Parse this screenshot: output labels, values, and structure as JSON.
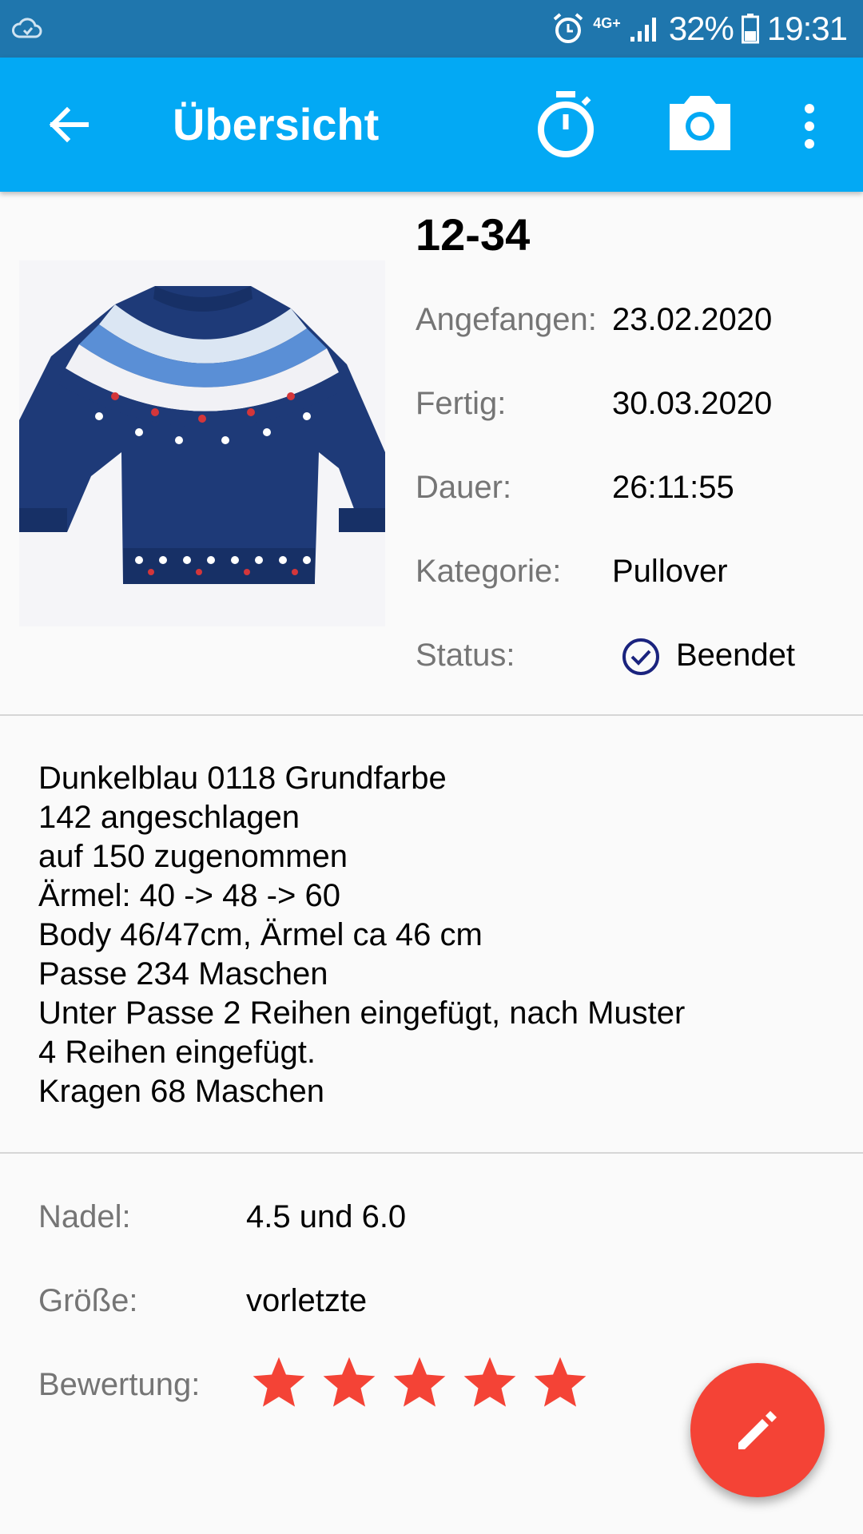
{
  "status_bar": {
    "network": "4G+",
    "battery": "32%",
    "time": "19:31"
  },
  "app_bar": {
    "title": "Übersicht",
    "back_icon": "arrow-back-icon",
    "timer_icon": "timer-icon",
    "camera_icon": "camera-icon",
    "overflow_icon": "more-vert-icon"
  },
  "item": {
    "title": "12-34",
    "photo_icon": "sweater-photo",
    "fields": [
      {
        "label": "Angefangen:",
        "value": "23.02.2020"
      },
      {
        "label": "Fertig:",
        "value": "30.03.2020"
      },
      {
        "label": "Dauer:",
        "value": "26:11:55"
      },
      {
        "label": "Kategorie:",
        "value": "Pullover"
      }
    ],
    "status": {
      "label": "Status:",
      "value": "Beendet",
      "icon": "check-circle-icon"
    }
  },
  "notes": [
    "Dunkelblau 0118 Grundfarbe",
    "142 angeschlagen",
    "auf 150 zugenommen",
    "Ärmel: 40 -> 48 -> 60",
    "Body 46/47cm, Ärmel ca 46 cm",
    "Passe 234 Maschen",
    "Unter Passe 2 Reihen eingefügt, nach Muster",
    "4 Reihen eingefügt.",
    "Kragen 68 Maschen"
  ],
  "details": {
    "needle": {
      "label": "Nadel:",
      "value": "4.5 und 6.0"
    },
    "size": {
      "label": "Größe:",
      "value": "vorletzte"
    },
    "rating": {
      "label": "Bewertung:",
      "value": 5,
      "max": 5
    }
  },
  "colors": {
    "status_bar": "#1f76ad",
    "app_bar": "#03a9f4",
    "accent": "#f44336",
    "status_icon": "#1a237e"
  },
  "fab": {
    "icon": "edit-icon"
  }
}
